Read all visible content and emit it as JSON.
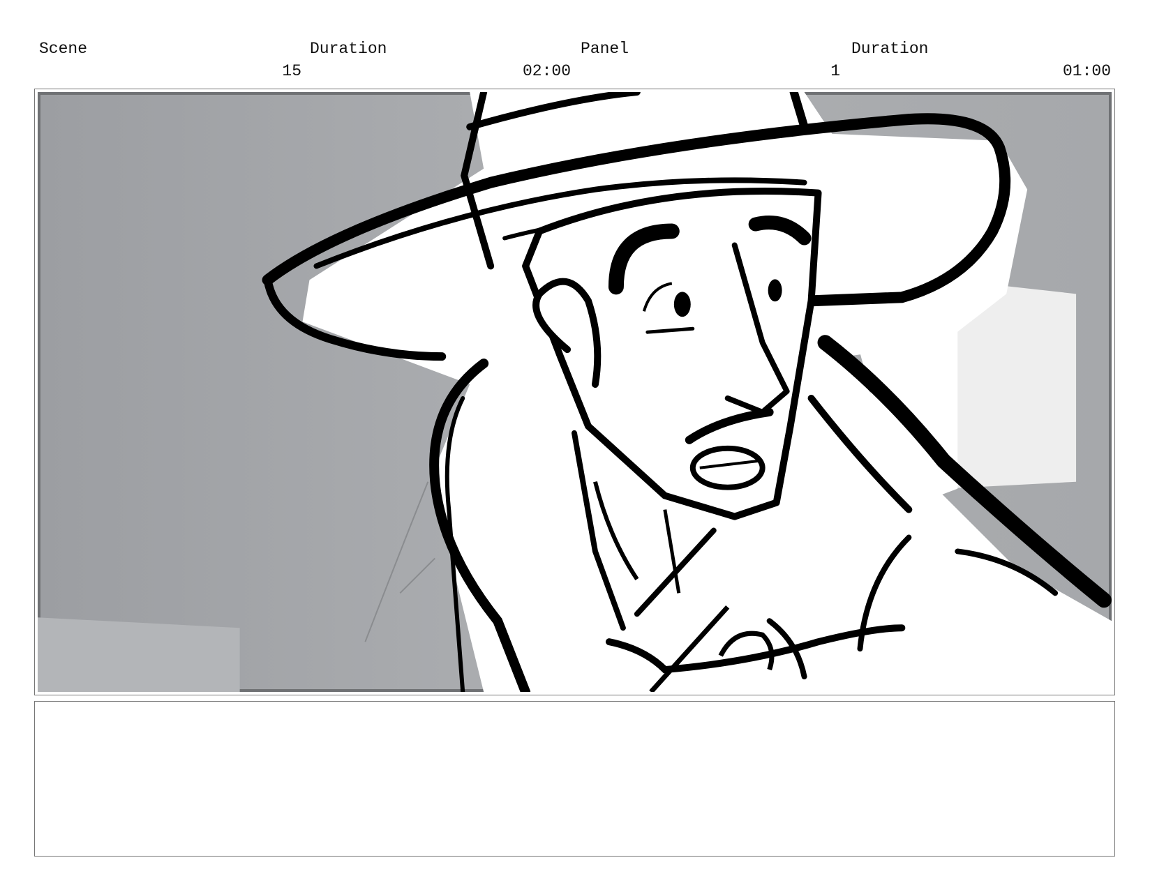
{
  "header": {
    "scene_label": "Scene",
    "scene_duration_label": "Duration",
    "panel_label": "Panel",
    "panel_duration_label": "Duration",
    "scene_value": "15",
    "scene_duration_value": "02:00",
    "panel_value": "1",
    "panel_duration_value": "01:00"
  },
  "panel": {
    "image_subject": "storyboard-sketch-man-in-wide-brim-hat",
    "background_color": "#a8aaad",
    "line_color": "#000000"
  },
  "notes": {
    "text": ""
  }
}
